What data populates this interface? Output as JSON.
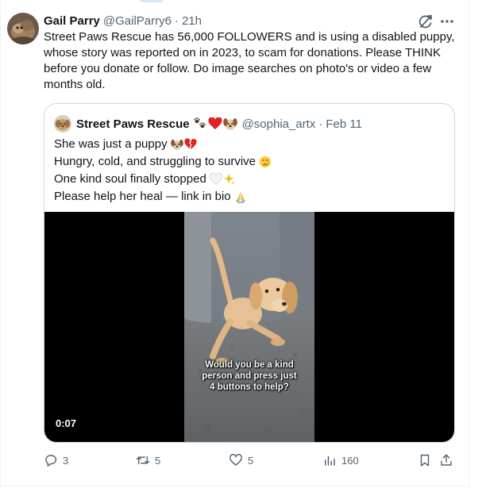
{
  "tweet": {
    "author_name": "Gail Parry",
    "author_handle": "@GailParry6",
    "separator": "·",
    "time": "21h",
    "text": "Street Paws Rescue has 56,000 FOLLOWERS and is using a disabled puppy, whose story was reported on in 2023, to scam for donations. Please THINK before you donate or follow.  Do image searches on photo's or video a few months old."
  },
  "quoted": {
    "author_name": "Street Paws Rescue",
    "name_emojis": [
      "paw-prints-icon",
      "red-heart-icon",
      "dog-face-icon"
    ],
    "author_handle": "@sophia_artx",
    "separator": "·",
    "time": "Feb 11",
    "lines": [
      {
        "text": "She was just a puppy",
        "emojis": [
          "dog-face-icon",
          "broken-heart-icon"
        ]
      },
      {
        "text": "Hungry, cold, and struggling to survive",
        "emojis": [
          "crying-face-icon"
        ]
      },
      {
        "text": "One kind soul finally stopped",
        "emojis": [
          "white-heart-icon",
          "sparkles-icon"
        ]
      },
      {
        "text": "Please help her heal — link in bio",
        "emojis": [
          "folded-hands-icon"
        ]
      }
    ],
    "video": {
      "caption_lines": [
        "Would you be a kind",
        "person and press just",
        "4 buttons to help?"
      ],
      "duration": "0:07"
    }
  },
  "actions": {
    "replies": "3",
    "reposts": "5",
    "likes": "5",
    "views": "160"
  },
  "colors": {
    "text": "#0f1419",
    "secondary": "#536471",
    "border": "#cfd9de",
    "heart": "#f91880"
  }
}
